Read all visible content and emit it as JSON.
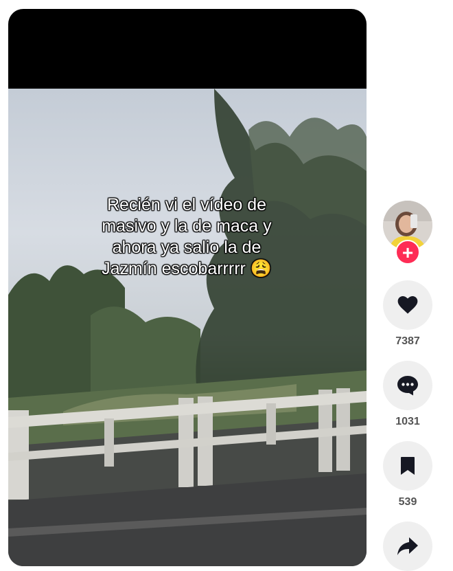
{
  "video": {
    "caption_lines": [
      "Recién vi el vídeo de",
      "masivo y la de maca y",
      "ahora ya salio la de",
      "Jazmín escobarrrrr 😩"
    ]
  },
  "creator": {
    "avatar_icon": "profile-photo",
    "follow_icon": "plus-icon",
    "follow_label": "+"
  },
  "actions": {
    "like": {
      "icon": "heart-icon",
      "count": "7387"
    },
    "comment": {
      "icon": "comment-icon",
      "count": "1031"
    },
    "save": {
      "icon": "bookmark-icon",
      "count": "539"
    },
    "share": {
      "icon": "share-icon"
    }
  },
  "colors": {
    "accent": "#fe2c55",
    "icon": "#161823",
    "button_bg": "#efefef",
    "count_text": "#545454"
  }
}
